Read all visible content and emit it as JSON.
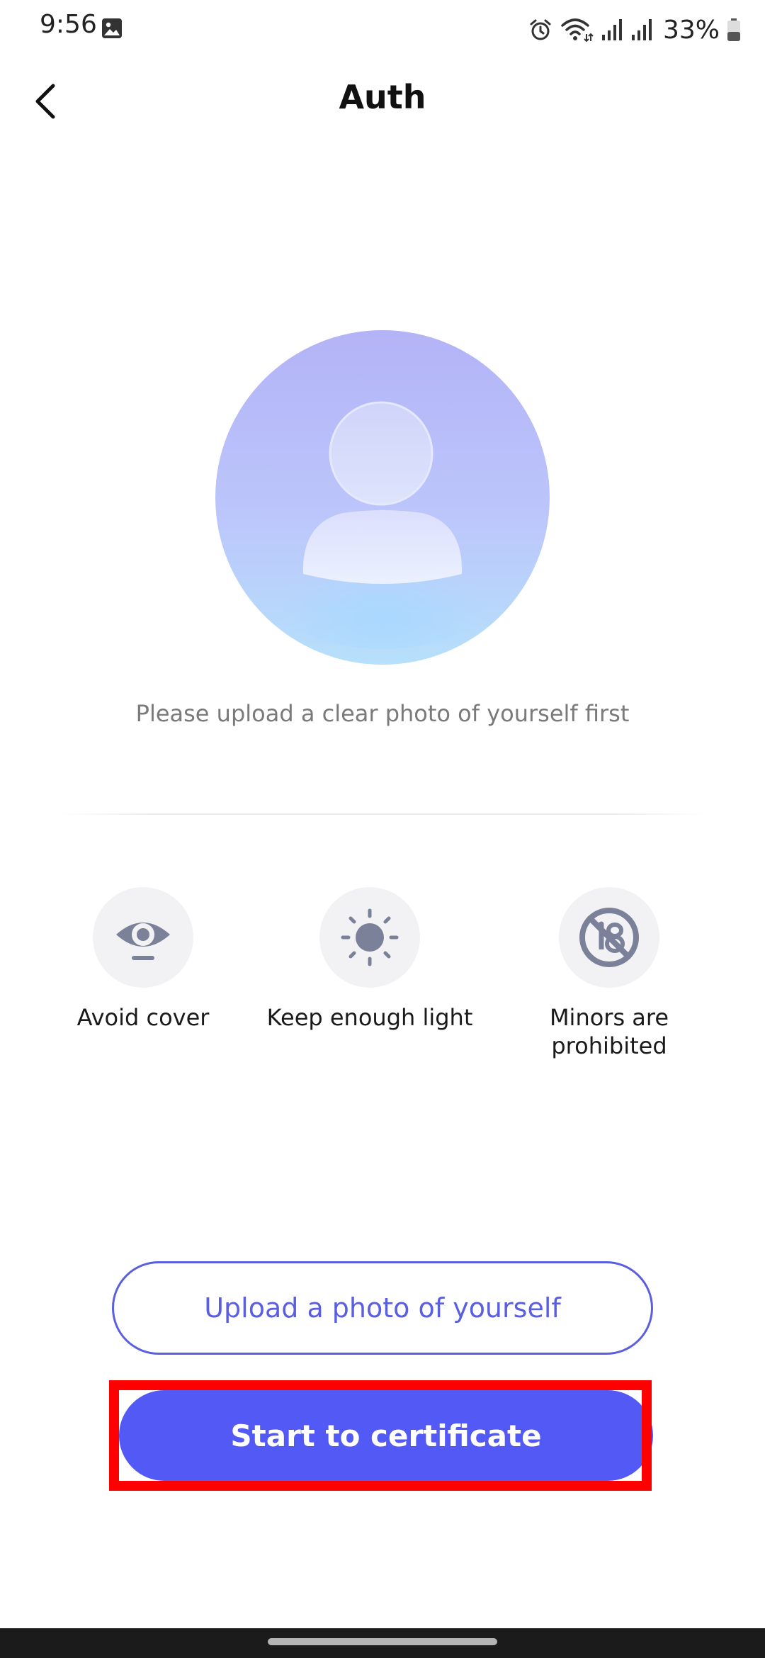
{
  "status_bar": {
    "time": "9:56",
    "battery": "33%"
  },
  "header": {
    "title": "Auth"
  },
  "main": {
    "instruction": "Please upload a clear photo of yourself first",
    "tips": [
      {
        "label": "Avoid cover",
        "icon": "eye-icon"
      },
      {
        "label": "Keep enough light",
        "icon": "sun-icon"
      },
      {
        "label": "Minors are prohibited",
        "icon": "no-18-icon"
      }
    ],
    "upload_label": "Upload a photo of yourself",
    "certificate_label": "Start to certificate"
  },
  "colors": {
    "accent": "#5359f5",
    "outline": "#5a5fe0",
    "highlight": "#ff0000"
  }
}
